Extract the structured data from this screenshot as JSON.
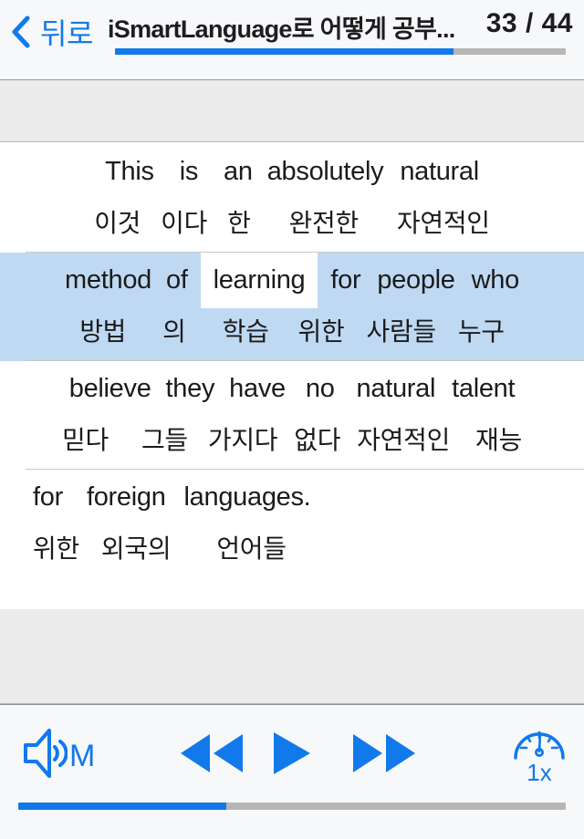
{
  "header": {
    "back_label": "뒤로",
    "back_icon": "chevron-left-icon",
    "title": "iSmartLanguage로 어떻게 공부...",
    "page_counter": "33 / 44",
    "current_page": 33,
    "total_pages": 44,
    "progress_percent": 75
  },
  "colors": {
    "accent_blue": "#1179ea",
    "highlight_row": "#bfd9f2",
    "band_grey": "#ececed",
    "track_grey": "#b6b6b6",
    "text_dark": "#1b1b1b"
  },
  "content": {
    "rows": [
      {
        "highlighted": false,
        "english": [
          "This",
          "is",
          "an",
          "absolutely",
          "natural"
        ],
        "korean": [
          "이것",
          "이다",
          "한",
          "완전한",
          "자연적인"
        ],
        "selected_word": null
      },
      {
        "highlighted": true,
        "english": [
          "method",
          "of",
          "learning",
          "for",
          "people",
          "who"
        ],
        "korean": [
          "방법",
          "의",
          "학습",
          "위한",
          "사람들",
          "누구"
        ],
        "selected_word": "learning"
      },
      {
        "highlighted": false,
        "english": [
          "believe",
          "they",
          "have",
          "no",
          "natural",
          "talent"
        ],
        "korean": [
          "믿다",
          "그들",
          "가지다",
          "없다",
          "자연적인",
          "재능"
        ],
        "selected_word": null
      },
      {
        "highlighted": false,
        "english": [
          "for",
          "foreign",
          "languages."
        ],
        "korean": [
          "위한",
          "외국의",
          "언어들"
        ],
        "selected_word": null
      }
    ]
  },
  "toolbar": {
    "volume": {
      "icon": "speaker-wave-icon",
      "label": "M"
    },
    "rewind": {
      "icon": "rewind-icon"
    },
    "play": {
      "icon": "play-icon"
    },
    "forward": {
      "icon": "fast-forward-icon"
    },
    "speed": {
      "icon": "speedometer-icon",
      "label": "1x"
    },
    "playback_progress_percent": 38
  }
}
